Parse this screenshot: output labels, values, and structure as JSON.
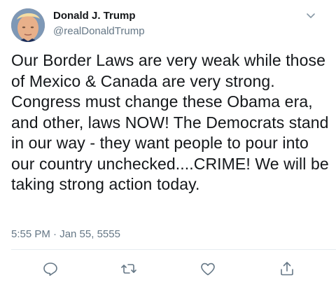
{
  "tweet": {
    "author_name": "Donald J. Trump",
    "author_handle": "@realDonaldTrump",
    "text": "Our Border Laws are very weak while those of Mexico & Canada are very strong. Congress must change these Obama era, and other, laws NOW! The Democrats stand in our way - they want people to pour into our country unchecked....CRIME! We will be taking strong action today.",
    "timestamp": "5:55 PM · Jan 55, 5555"
  },
  "icons": {
    "menu": "chevron-down-icon",
    "reply": "reply-icon",
    "retweet": "retweet-icon",
    "like": "heart-icon",
    "share": "share-icon"
  },
  "colors": {
    "text": "#14171a",
    "secondary": "#657786",
    "divider": "#e6ecf0"
  }
}
